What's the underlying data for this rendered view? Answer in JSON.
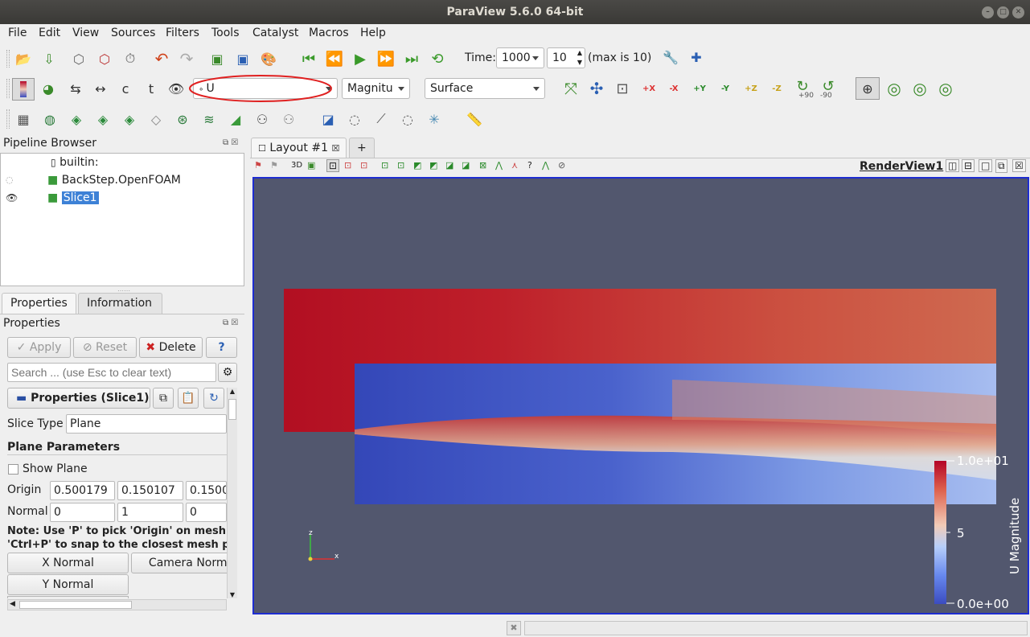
{
  "window": {
    "title": "ParaView 5.6.0 64-bit"
  },
  "menu": [
    "File",
    "Edit",
    "View",
    "Sources",
    "Filters",
    "Tools",
    "Catalyst",
    "Macros",
    "Help"
  ],
  "time": {
    "label": "Time:",
    "value": "1000",
    "step": "10",
    "max_label": "(max is 10)"
  },
  "color_toolbar": {
    "array": "U",
    "component": "Magnitu",
    "representation": "Surface",
    "rot_plus": "+90",
    "rot_minus": "-90",
    "view_dirs": [
      "+X",
      "-X",
      "+Y",
      "-Y",
      "+Z",
      "-Z"
    ]
  },
  "pipeline": {
    "title": "Pipeline Browser",
    "items": [
      {
        "label": "builtin:"
      },
      {
        "label": "BackStep.OpenFOAM"
      },
      {
        "label": "Slice1"
      }
    ]
  },
  "layout": {
    "tab": "Layout #1",
    "add": "+",
    "view_label": "RenderView1",
    "mode3d": "3D"
  },
  "tabs": {
    "properties": "Properties",
    "information": "Information"
  },
  "properties": {
    "title": "Properties",
    "apply": "Apply",
    "reset": "Reset",
    "delete": "Delete",
    "help": "?",
    "search_placeholder": "Search ... (use Esc to clear text)",
    "section": "Properties (Slice1)",
    "slice_type_label": "Slice Type",
    "slice_type": "Plane",
    "plane_params": "Plane Parameters",
    "show_plane": "Show Plane",
    "origin_label": "Origin",
    "origin": [
      "0.500179",
      "0.150107",
      "0.1500"
    ],
    "normal_label": "Normal",
    "normal": [
      "0",
      "1",
      "0"
    ],
    "note1": "Note: Use 'P' to pick 'Origin' on mesh o",
    "note2": "'Ctrl+P' to snap to the closest mesh po",
    "x_normal": "X Normal",
    "camera_normal": "Camera Norma",
    "y_normal": "Y Normal"
  },
  "render": {
    "colorbar": {
      "title": "U Magnitude",
      "max": "1.0e+01",
      "mid": "5",
      "min": "0.0e+00",
      "colors": [
        "#b40426",
        "#dd604c",
        "#f2cbb7",
        "#b6cefa",
        "#6788ee",
        "#3b4cc0"
      ]
    },
    "axes": {
      "x": "x",
      "z": "z"
    },
    "background": "#52576e"
  }
}
